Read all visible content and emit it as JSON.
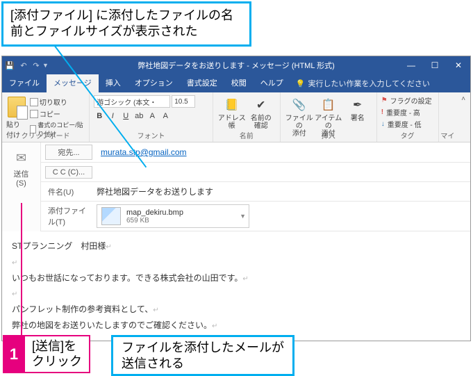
{
  "callouts": {
    "top": "[添付ファイル] に添付したファイルの名前とファイルサイズが表示された",
    "step_num": "1",
    "step_text_l1": "[送信]を",
    "step_text_l2": "クリック",
    "bottom_l1": "ファイルを添付したメールが",
    "bottom_l2": "送信される"
  },
  "titlebar": {
    "title": "弊社地図データをお送りします - メッセージ (HTML 形式)",
    "min": "—",
    "max": "☐",
    "close": "✕"
  },
  "tabs": {
    "file": "ファイル",
    "message": "メッセージ",
    "insert": "挿入",
    "options": "オプション",
    "format": "書式設定",
    "review": "校閲",
    "help": "ヘルプ",
    "tell_me": "実行したい作業を入力してください"
  },
  "ribbon": {
    "paste": "貼り付け",
    "cut": "切り取り",
    "copy": "コピー",
    "format_painter": "書式のコピー/貼り付け",
    "clipboard_label": "クリップボード",
    "font_name": "游ゴシック (本文・",
    "font_size": "10.5",
    "font_label": "フォント",
    "address_book": "アドレス帳",
    "check_names_l1": "名前の",
    "check_names_l2": "確認",
    "names_label": "名前",
    "attach_file_l1": "ファイルの",
    "attach_file_l2": "添付",
    "attach_item_l1": "アイテムの",
    "attach_item_l2": "添付",
    "signature_l1": "署名",
    "include_label": "挿入",
    "flag": "フラグの設定",
    "importance_high": "重要度 - 高",
    "importance_low": "重要度 - 低",
    "tags_label": "タグ",
    "my_label": "マイ"
  },
  "send": {
    "label_l1": "送信",
    "label_l2": "(S)"
  },
  "fields": {
    "to_label": "宛先...",
    "to_value": "murata.stp@gmail.com",
    "cc_label": "C C (C)...",
    "subject_label": "件名(U)",
    "subject_value": "弊社地図データをお送りします",
    "attach_label": "添付ファイル(T)",
    "attach_name": "map_dekiru.bmp",
    "attach_size": "659 KB"
  },
  "body": {
    "l1": "STプランニング　村田様",
    "l2": "いつもお世話になっております。できる株式会社の山田です。",
    "l3": "パンフレット制作の参考資料として、",
    "l4": "弊社の地図をお送りいたしますのでご確認ください。"
  }
}
